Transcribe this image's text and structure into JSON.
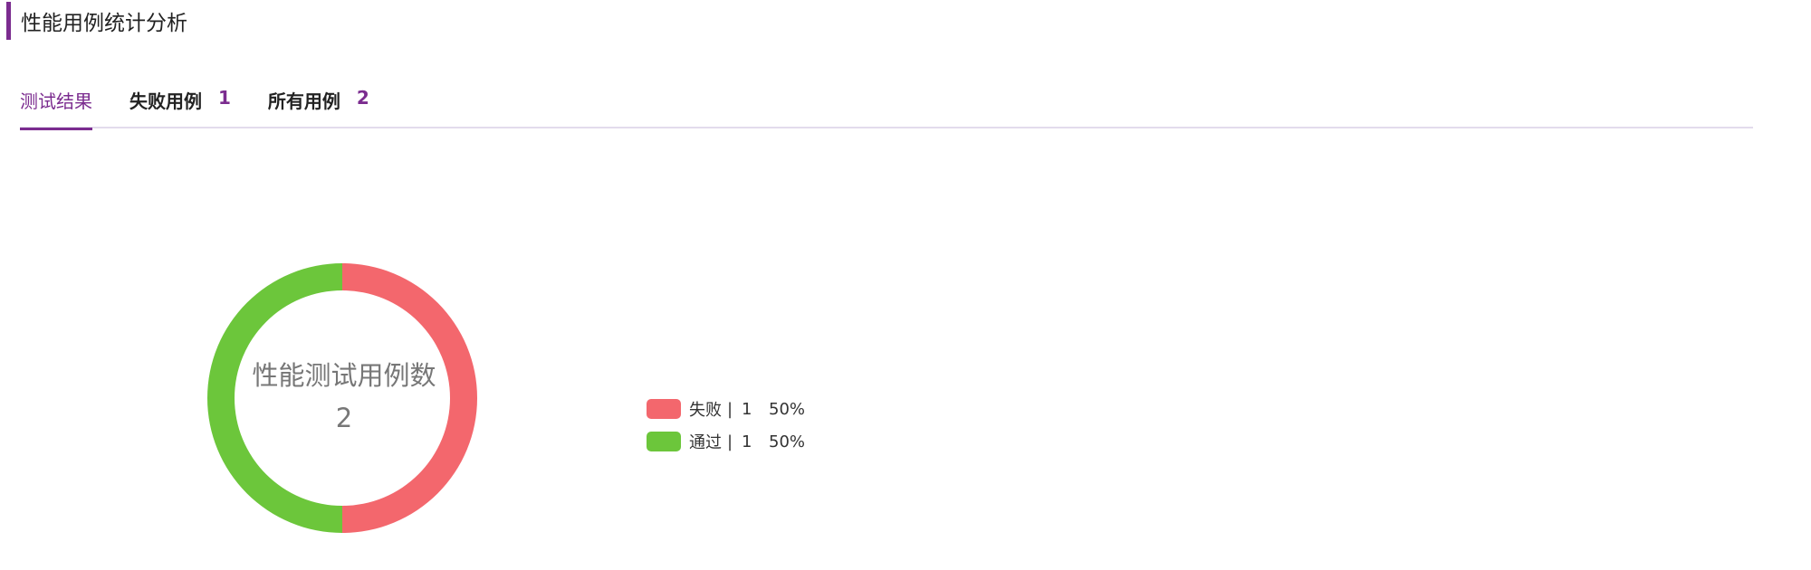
{
  "header": {
    "title": "性能用例统计分析"
  },
  "tabs": [
    {
      "label": "测试结果",
      "count": ""
    },
    {
      "label": "失败用例",
      "count": "1"
    },
    {
      "label": "所有用例",
      "count": "2"
    }
  ],
  "chart_data": {
    "type": "pie",
    "style": "donut",
    "center_title": "性能测试用例数",
    "center_value": "2",
    "slices": [
      {
        "name": "失败",
        "value": 1,
        "percent": "50%",
        "color": "#f3676d"
      },
      {
        "name": "通过",
        "value": 1,
        "percent": "50%",
        "color": "#6cc63b"
      }
    ],
    "legend_position": "right"
  },
  "legend": {
    "separator": "|",
    "items": [
      {
        "name": "失败",
        "count": "1",
        "percent": "50%",
        "color": "#f3676d"
      },
      {
        "name": "通过",
        "count": "1",
        "percent": "50%",
        "color": "#6cc63b"
      }
    ]
  },
  "colors": {
    "accent": "#7b2c8f",
    "tab_line": "#e3dcec"
  }
}
